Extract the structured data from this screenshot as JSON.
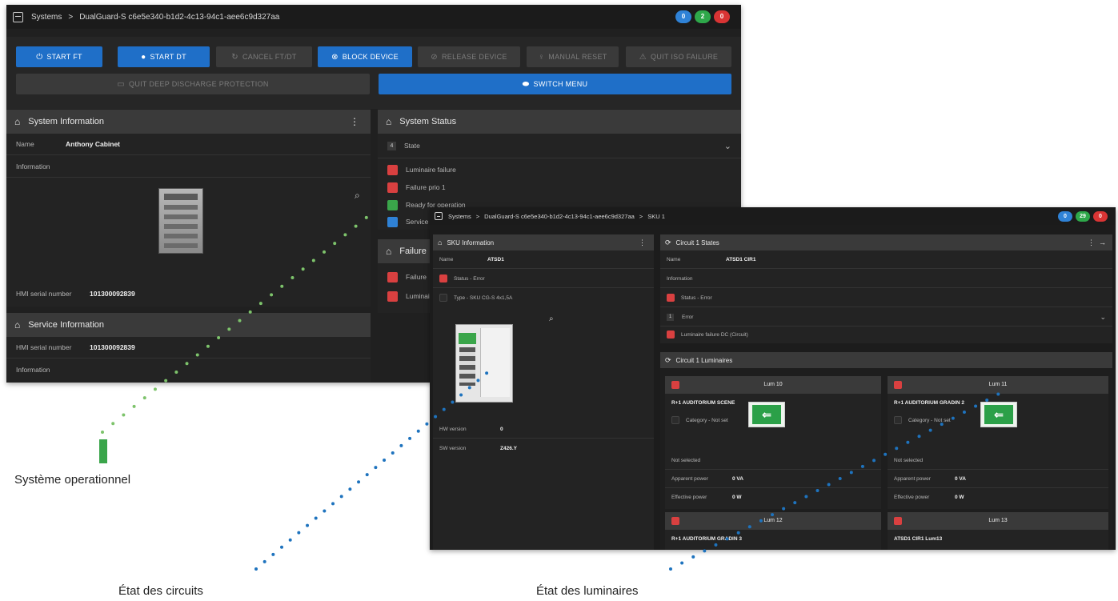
{
  "colors": {
    "accent_blue": "#1f6fc8",
    "status_red": "#d94040",
    "status_green": "#3aa54a",
    "status_blue": "#2f82d6",
    "dots_green": "#7dc36b",
    "dots_blue": "#1e73be"
  },
  "win1": {
    "breadcrumb": {
      "root": "Systems",
      "sep": ">",
      "device": "DualGuard-S c6e5e340-b1d2-4c13-94c1-aee6c9d327aa"
    },
    "badges": {
      "blue": "0",
      "green": "2",
      "red": "0"
    },
    "buttons": {
      "start_ft": "START FT",
      "start_dt": "START DT",
      "cancel": "CANCEL FT/DT",
      "block": "BLOCK DEVICE",
      "release": "RELEASE DEVICE",
      "manual_reset": "MANUAL RESET",
      "quit_iso": "QUIT ISO FAILURE",
      "quit_deep": "QUIT DEEP DISCHARGE PROTECTION",
      "switch_menu": "SWITCH MENU"
    },
    "system_info": {
      "title": "System Information",
      "name_label": "Name",
      "name_value": "Anthony Cabinet",
      "info_label": "Information",
      "hmi_label": "HMI serial number",
      "hmi_value": "101300092839"
    },
    "service_info": {
      "title": "Service Information",
      "hmi_label": "HMI serial number",
      "hmi_value": "101300092839",
      "info_label": "Information"
    },
    "system_status": {
      "title": "System Status",
      "state_count": "4",
      "state_label": "State",
      "items": [
        "Luminaire failure",
        "Failure prio 1",
        "Ready for operation",
        "Service"
      ]
    },
    "failure": {
      "title": "Failure",
      "items": [
        "Failure",
        "Luminaire"
      ]
    }
  },
  "win2": {
    "breadcrumb": {
      "root": "Systems",
      "sep": ">",
      "device": "DualGuard-S c6e5e340-b1d2-4c13-94c1-aee6c9d327aa",
      "sep2": ">",
      "sku": "SKU 1"
    },
    "badges": {
      "blue": "0",
      "green": "29",
      "red": "0"
    },
    "sku_info": {
      "title": "SKU Information",
      "name_label": "Name",
      "name_value": "ATSD1",
      "status": "Status - Error",
      "type": "Type - SKU CG-S 4x1,5A",
      "hw_label": "HW version",
      "hw_value": "0",
      "sw_label": "SW version",
      "sw_value": "Z426.Y"
    },
    "circuit_states": {
      "title": "Circuit 1 States",
      "name_label": "Name",
      "name_value": "ATSD1 CIR1",
      "info_label": "Information",
      "status": "Status - Error",
      "error_count": "1",
      "error_label": "Error",
      "failure": "Luminaire failure DC (Circuit)"
    },
    "circuit_lums": {
      "title": "Circuit 1 Luminaires"
    },
    "lum10": {
      "title": "Lum 10",
      "location": "R+1 AUDITORIUM SCENE",
      "category": "Category - Not set",
      "selected": "Not selected",
      "ap_label": "Apparent power",
      "ap_value": "0 VA",
      "ep_label": "Effective power",
      "ep_value": "0 W"
    },
    "lum11": {
      "title": "Lum 11",
      "location": "R+1 AUDITORIUM GRADIN 2",
      "category": "Category - Not set",
      "selected": "Not selected",
      "ap_label": "Apparent power",
      "ap_value": "0 VA",
      "ep_label": "Effective power",
      "ep_value": "0 W"
    },
    "lum12": {
      "title": "Lum 12",
      "location": "R+1 AUDITORIUM GRADIN 3"
    },
    "lum13": {
      "title": "Lum 13",
      "location": "ATSD1 CIR1 Lum13"
    }
  },
  "captions": {
    "system": "Système operationnel",
    "circuits": "État des circuits",
    "luminaires": "État des luminaires"
  }
}
